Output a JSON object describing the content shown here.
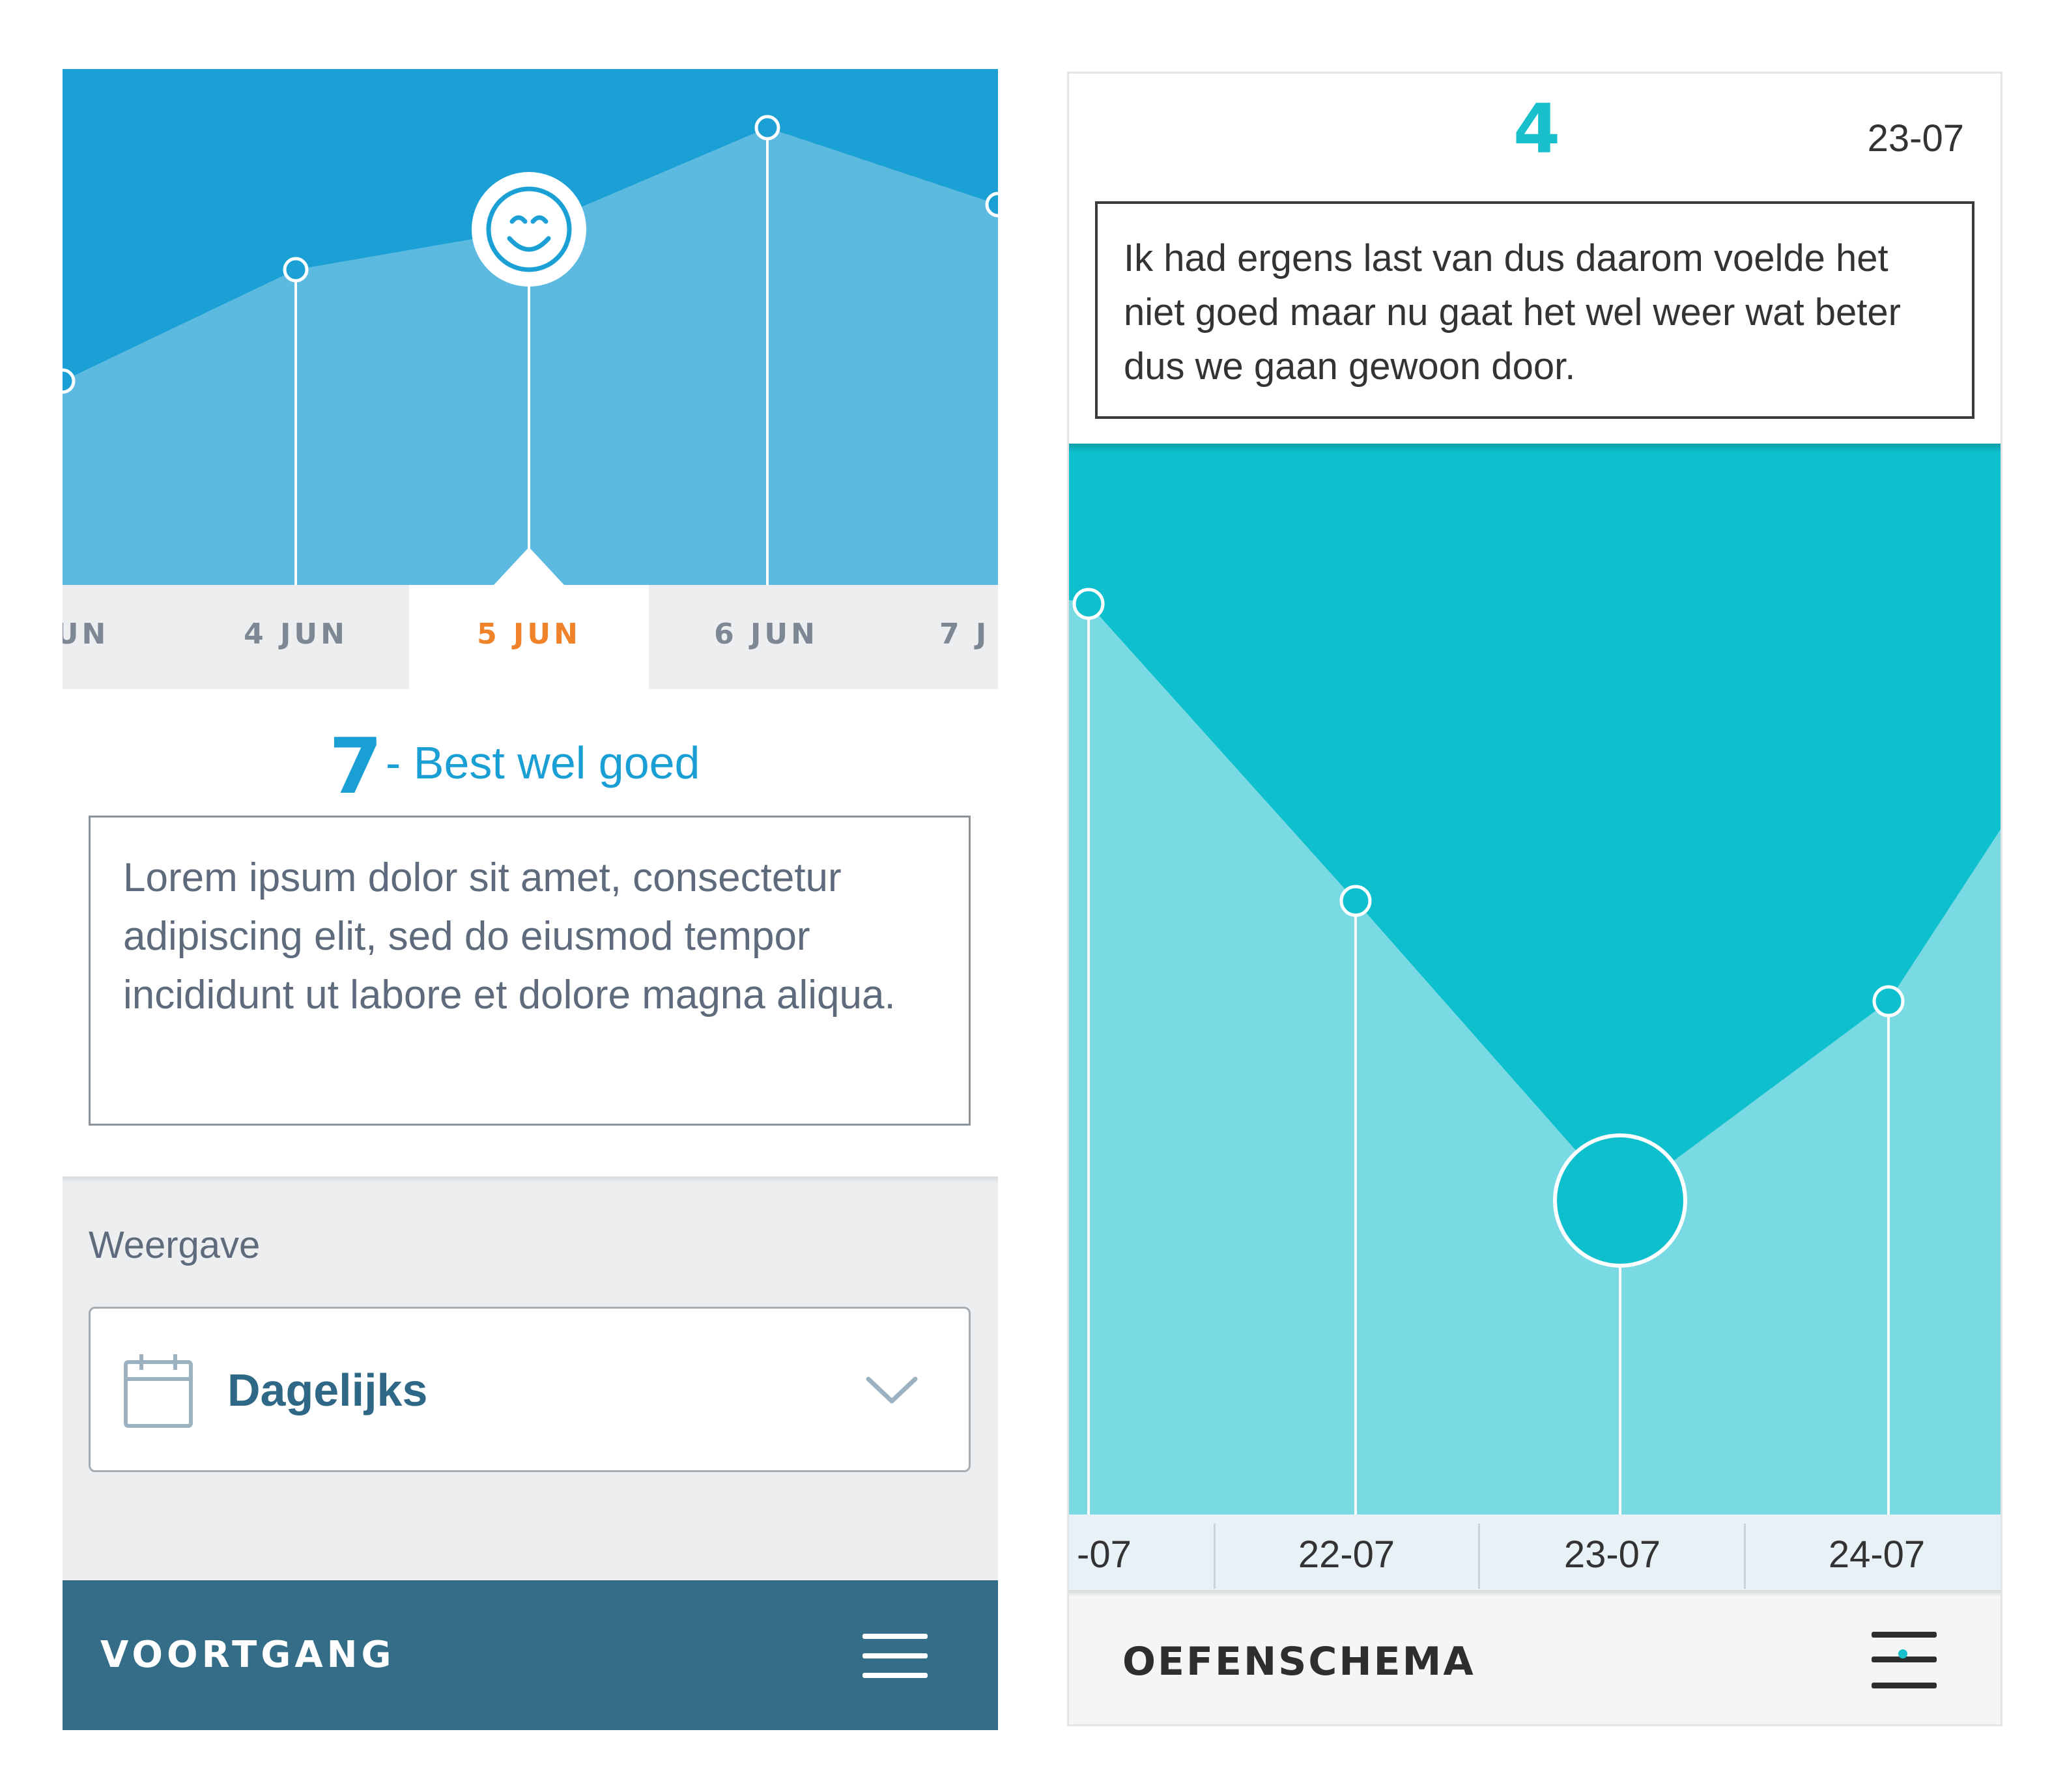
{
  "left_screen": {
    "tabs": [
      {
        "label": "UN"
      },
      {
        "label": "4 JUN"
      },
      {
        "label": "5 JUN"
      },
      {
        "label": "6 JUN"
      },
      {
        "label": "7 J"
      }
    ],
    "active_tab": "5 JUN",
    "score": "7",
    "score_label": "- Best wel goed",
    "note": "Lorem ipsum dolor sit amet, consectetur adipiscing elit, sed do eiusmod tempor incididunt ut labore et dolore magna aliqua.",
    "settings_label": "Weergave",
    "view_select": {
      "value": "Dagelijks",
      "icon": "calendar-icon",
      "toggle_icon": "chevron-down-icon"
    },
    "footer_title": "VOORTGANG",
    "menu_icon": "hamburger-menu-icon",
    "selected_icon": "smiley-face-icon"
  },
  "right_screen": {
    "score": "4",
    "date": "23-07",
    "note": "Ik had ergens last van dus daarom voelde het niet goed maar nu gaat het wel weer wat beter dus we gaan gewoon door.",
    "tabs": [
      {
        "label": "-07"
      },
      {
        "label": "22-07"
      },
      {
        "label": "23-07"
      },
      {
        "label": "24-07"
      }
    ],
    "footer_title": "OEFENSCHEMA",
    "menu_icon": "hamburger-menu-icon"
  },
  "colors": {
    "left_chart_bg": "#1aa0d4",
    "left_chart_area": "#5cb9df",
    "active_orange": "#f0822a",
    "left_blue_text": "#1a9fd5",
    "footer_left": "#336d87",
    "right_chart_bg": "#0ebfcd",
    "right_chart_area": "#7adae3",
    "right_accent": "#19c0cc"
  }
}
